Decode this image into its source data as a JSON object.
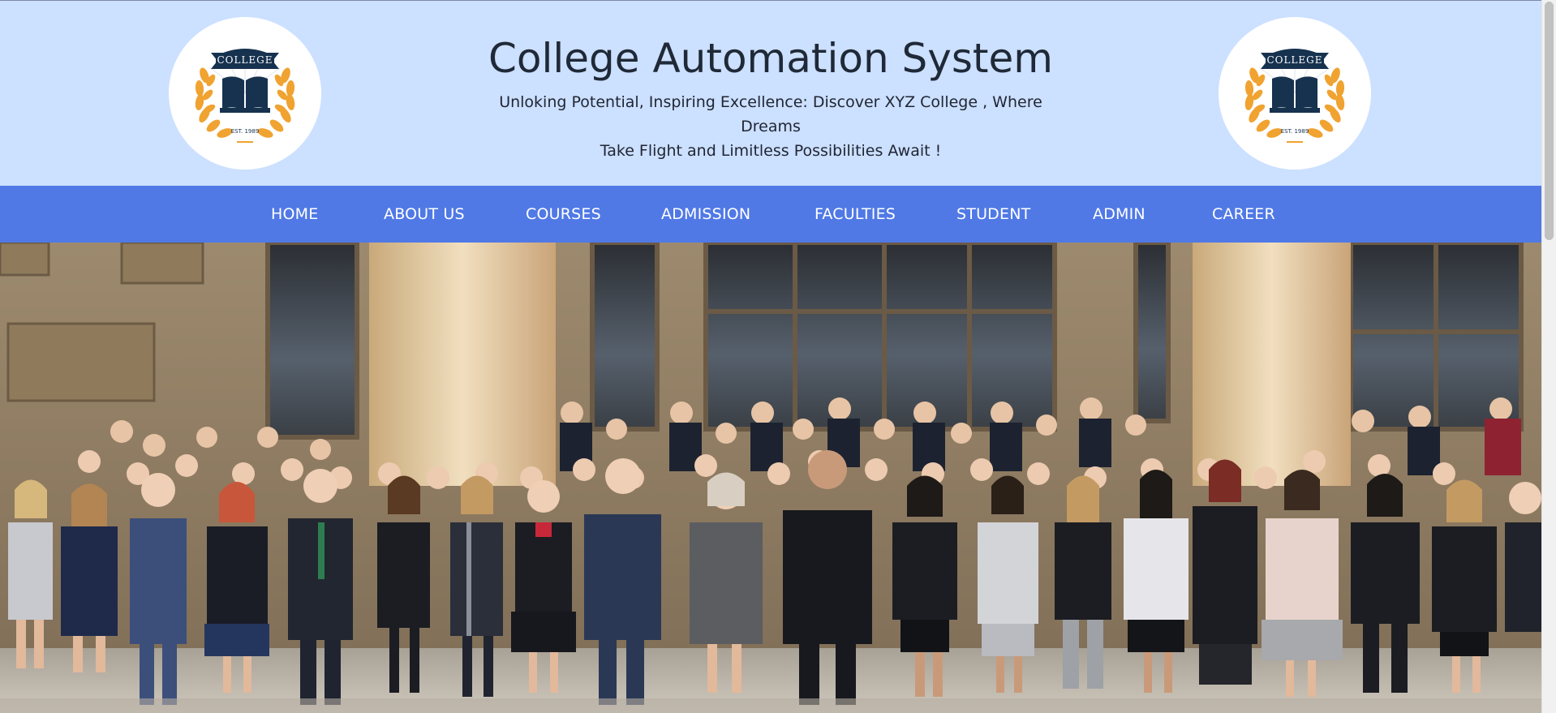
{
  "header": {
    "title": "College Automation System",
    "tagline_line1": "Unloking Potential, Inspiring Excellence: Discover XYZ College , Where Dreams",
    "tagline_line2": "Take Flight and Limitless Possibilities Await !"
  },
  "logo": {
    "ribbon_text": "COLLEGE",
    "est_text": "EST. 1989",
    "icon": "college-emblem-book-laurel"
  },
  "nav": {
    "items": [
      {
        "label": "HOME"
      },
      {
        "label": "ABOUT US"
      },
      {
        "label": "COURSES"
      },
      {
        "label": "ADMISSION"
      },
      {
        "label": "FACULTIES"
      },
      {
        "label": "STUDENT"
      },
      {
        "label": "ADMIN"
      },
      {
        "label": "CAREER"
      }
    ]
  },
  "hero": {
    "image": "group-photo-students-in-front-of-sandstone-building"
  },
  "colors": {
    "header_bg": "#cce0ff",
    "nav_bg": "#5079e6",
    "nav_text": "#ffffff",
    "title_text": "#1f2937",
    "emblem_navy": "#16324f",
    "emblem_gold": "#f0a330"
  }
}
